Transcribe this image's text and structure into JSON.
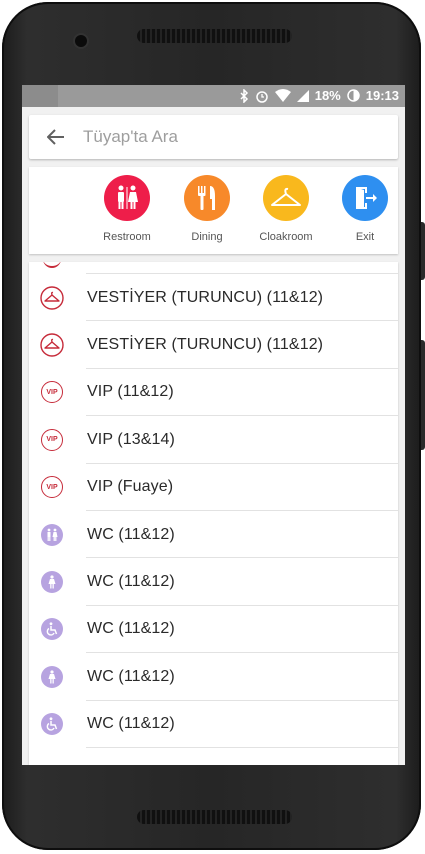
{
  "status_bar": {
    "battery": "18%",
    "time": "19:13"
  },
  "search": {
    "placeholder": "Tüyap'ta Ara"
  },
  "quick_actions": [
    {
      "label": "Restroom",
      "color": "#ee1e4a",
      "icon": "restroom-icon"
    },
    {
      "label": "Dining",
      "color": "#f7892a",
      "icon": "dining-icon"
    },
    {
      "label": "Cloakroom",
      "color": "#f9b81d",
      "icon": "hanger-icon"
    },
    {
      "label": "Exit",
      "color": "#2e8ff0",
      "icon": "exit-icon"
    }
  ],
  "list": {
    "items": [
      {
        "label": "VESTİYER (TURUNCU) (11&12)",
        "icon": "hanger-icon"
      },
      {
        "label": "VESTİYER (TURUNCU) (11&12)",
        "icon": "hanger-icon"
      },
      {
        "label": "VIP (11&12)",
        "icon": "vip-icon"
      },
      {
        "label": "VIP (13&14)",
        "icon": "vip-icon"
      },
      {
        "label": "VIP (Fuaye)",
        "icon": "vip-icon"
      },
      {
        "label": "WC (11&12)",
        "icon": "restroom-icon"
      },
      {
        "label": "WC (11&12)",
        "icon": "woman-icon"
      },
      {
        "label": "WC (11&12)",
        "icon": "wheelchair-icon"
      },
      {
        "label": "WC (11&12)",
        "icon": "woman-icon"
      },
      {
        "label": "WC (11&12)",
        "icon": "wheelchair-icon"
      }
    ]
  },
  "colors": {
    "accent_red": "#c62b3a",
    "wc_purple": "#b7a3e0"
  }
}
